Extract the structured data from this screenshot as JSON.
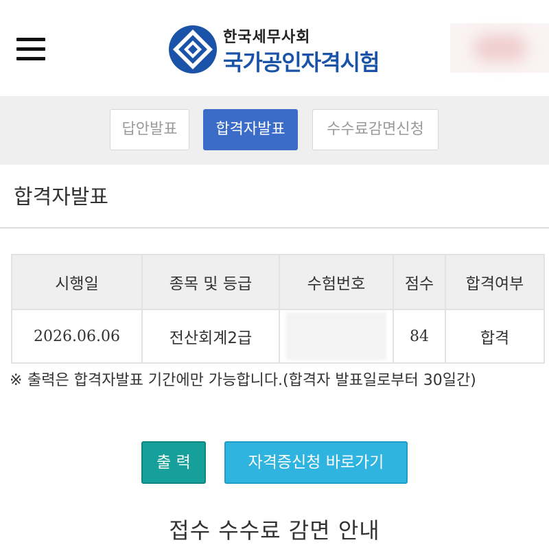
{
  "header": {
    "org_name": "한국세무사회",
    "exam_name": "국가공인자격시험"
  },
  "tabs": [
    {
      "label": "답안발표",
      "active": false
    },
    {
      "label": "합격자발표",
      "active": true
    },
    {
      "label": "수수료감면신청",
      "active": false
    }
  ],
  "section_title": "합격자발표",
  "table": {
    "headers": [
      "시행일",
      "종목 및 등급",
      "수험번호",
      "점수",
      "합격여부"
    ],
    "row": {
      "date": "2026.06.06",
      "subject": "전산회계2급",
      "exam_number": "",
      "score": "84",
      "result": "합격"
    }
  },
  "note": {
    "mark": "※",
    "text": "출력은 합격자발표 기간에만 가능합니다.(합격자 발표일로부터 30일간)"
  },
  "buttons": {
    "print": "출 력",
    "certificate": "자격증신청 바로가기"
  },
  "bottom_title": "접수 수수료 감면 안내",
  "colors": {
    "accent": "#3a6cc8",
    "print_button": "#16a09b",
    "cert_button": "#2fb4e0",
    "brand_blue": "#1a53a8"
  },
  "icons": {
    "menu": "hamburger-menu-icon",
    "logo": "diamond-emblem-logo"
  }
}
